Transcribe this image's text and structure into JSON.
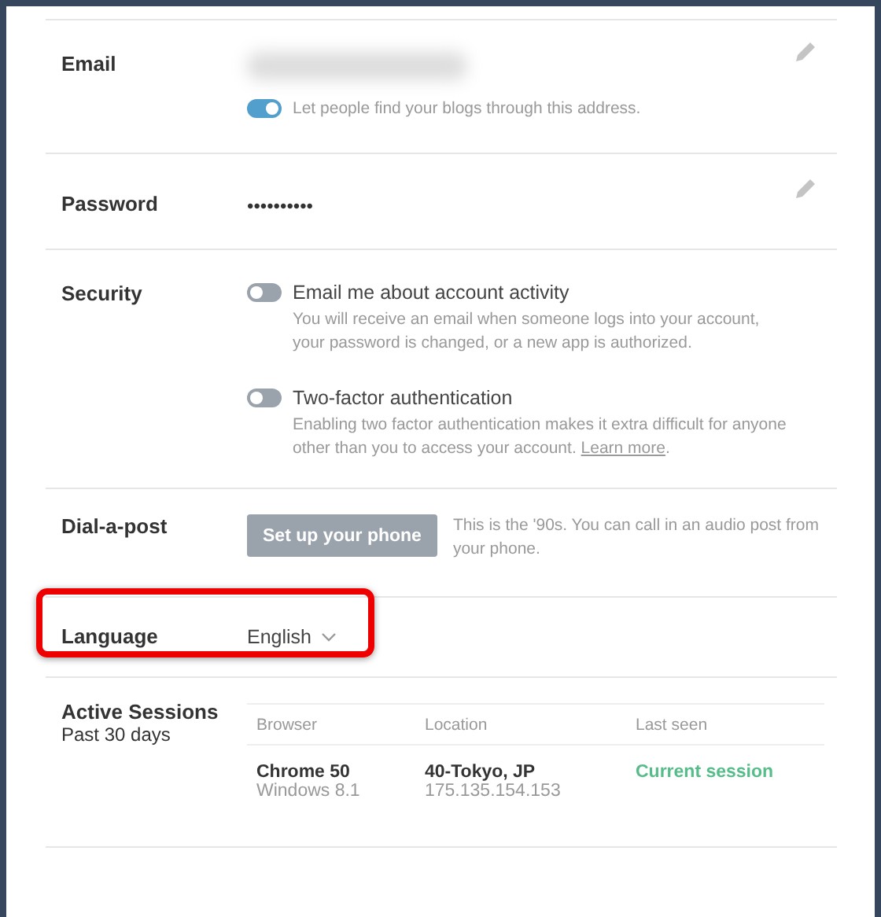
{
  "sections": [
    {
      "kind": "email",
      "label": "Email",
      "toggle": {
        "on": true,
        "label": "Let people find your blogs through this address."
      },
      "editable": true
    },
    {
      "kind": "password",
      "label": "Password",
      "value": "••••••••••",
      "editable": true
    },
    {
      "kind": "security",
      "label": "Security",
      "options": [
        {
          "on": false,
          "title": "Email me about account activity",
          "description": "You will receive an email when someone logs into your account, your password is changed, or a new app is authorized."
        },
        {
          "on": false,
          "title": "Two-factor authentication",
          "description": "Enabling two factor authentication makes it extra difficult for anyone other than you to access your account.",
          "link": "Learn more",
          "after": "."
        }
      ]
    },
    {
      "kind": "dial",
      "label": "Dial-a-post",
      "button": "Set up your phone",
      "note": "This is the '90s. You can call in an audio post from your phone."
    },
    {
      "kind": "language",
      "label": "Language",
      "value": "English",
      "highlighted": true
    },
    {
      "kind": "sessions",
      "label": "Active Sessions",
      "sublabel": "Past 30 days",
      "columns": [
        "Browser",
        "Location",
        "Last seen"
      ],
      "rows": [
        {
          "browser": "Chrome 50",
          "os": "Windows 8.1",
          "location": "40-Tokyo, JP",
          "ip": "175.135.154.153",
          "last_seen": "Current session"
        }
      ]
    }
  ]
}
